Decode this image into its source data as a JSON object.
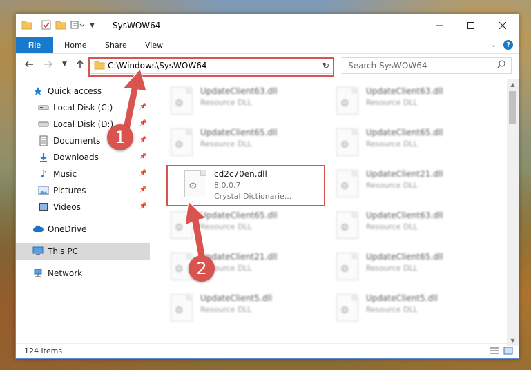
{
  "window": {
    "title": "SysWOW64"
  },
  "ribbon": {
    "tabs": [
      "File",
      "Home",
      "Share",
      "View"
    ]
  },
  "navigation": {
    "address": "C:\\Windows\\SysWOW64",
    "search_placeholder": "Search SysWOW64"
  },
  "sidebar": {
    "items": [
      {
        "label": "Quick access",
        "icon": "star-icon",
        "pinned": false
      },
      {
        "label": "Local Disk (C:)",
        "icon": "drive-icon",
        "pinned": true
      },
      {
        "label": "Local Disk (D:)",
        "icon": "drive-icon",
        "pinned": true
      },
      {
        "label": "Documents",
        "icon": "documents-icon",
        "pinned": true
      },
      {
        "label": "Downloads",
        "icon": "download-icon",
        "pinned": true
      },
      {
        "label": "Music",
        "icon": "music-icon",
        "pinned": true
      },
      {
        "label": "Pictures",
        "icon": "pictures-icon",
        "pinned": true
      },
      {
        "label": "Videos",
        "icon": "videos-icon",
        "pinned": true
      },
      {
        "label": "OneDrive",
        "icon": "cloud-icon",
        "pinned": false
      },
      {
        "label": "This PC",
        "icon": "computer-icon",
        "pinned": false,
        "selected": true
      },
      {
        "label": "Network",
        "icon": "network-icon",
        "pinned": false
      }
    ]
  },
  "files": [
    {
      "name": "UpdateClient63.dll",
      "desc": "Resource DLL",
      "blurred": true
    },
    {
      "name": "UpdateClient63.dll",
      "desc": "Resource DLL",
      "blurred": true
    },
    {
      "name": "UpdateClient65.dll",
      "desc": "Resource DLL",
      "blurred": true
    },
    {
      "name": "UpdateClient65.dll",
      "desc": "Resource DLL",
      "blurred": true
    },
    {
      "name": "cd2c70en.dll",
      "version": "8.0.0.7",
      "desc": "Crystal Dictionarie...",
      "blurred": false,
      "highlighted": true
    },
    {
      "name": "UpdateClient21.dll",
      "desc": "Resource DLL",
      "blurred": true
    },
    {
      "name": "UpdateClient65.dll",
      "desc": "Resource DLL",
      "blurred": true
    },
    {
      "name": "UpdateClient63.dll",
      "desc": "Resource DLL",
      "blurred": true
    },
    {
      "name": "UpdateClient21.dll",
      "desc": "Resource DLL",
      "blurred": true
    },
    {
      "name": "UpdateClient65.dll",
      "desc": "Resource DLL",
      "blurred": true
    },
    {
      "name": "UpdateClient5.dll",
      "desc": "Resource DLL",
      "blurred": true
    },
    {
      "name": "UpdateClient5.dll",
      "desc": "Resource DLL",
      "blurred": true
    }
  ],
  "status": {
    "item_count": "124 items"
  },
  "annotations": {
    "step1": "1",
    "step2": "2",
    "color": "#d9534f"
  }
}
